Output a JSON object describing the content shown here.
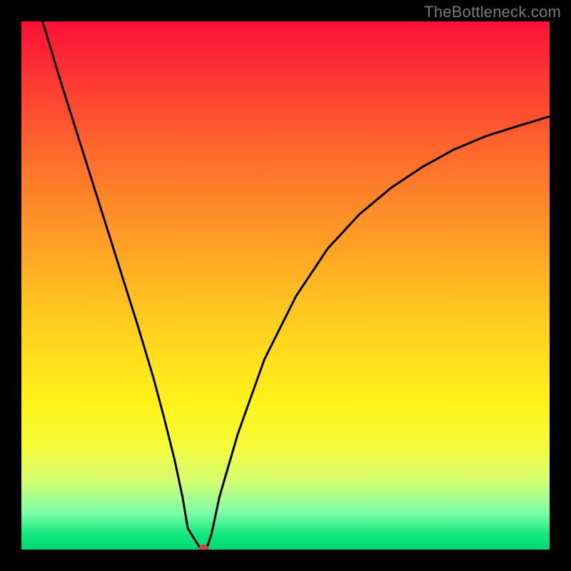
{
  "watermark": "TheBottleneck.com",
  "chart_data": {
    "type": "line",
    "title": "",
    "xlabel": "",
    "ylabel": "",
    "xlim": [
      0,
      100
    ],
    "ylim": [
      0,
      100
    ],
    "grid": false,
    "legend": false,
    "background_gradient_stops": [
      {
        "pct": 0,
        "color": "#fb1037"
      },
      {
        "pct": 12,
        "color": "#fd3b33"
      },
      {
        "pct": 25,
        "color": "#ff6a2d"
      },
      {
        "pct": 37,
        "color": "#ff8f27"
      },
      {
        "pct": 50,
        "color": "#ffb822"
      },
      {
        "pct": 62,
        "color": "#ffda1d"
      },
      {
        "pct": 72,
        "color": "#fff21a"
      },
      {
        "pct": 80,
        "color": "#f6fb37"
      },
      {
        "pct": 87,
        "color": "#d6fd72"
      },
      {
        "pct": 93,
        "color": "#7cfea7"
      },
      {
        "pct": 97,
        "color": "#17e87f"
      },
      {
        "pct": 100,
        "color": "#00d873"
      }
    ],
    "series": [
      {
        "name": "curve",
        "stroke": "#000000",
        "stroke_width": 3,
        "x": [
          4,
          7,
          10,
          13,
          16,
          19,
          22,
          25,
          27,
          29,
          30.5,
          31.5,
          34,
          35,
          36,
          37.5,
          41,
          46,
          52,
          58,
          64,
          70,
          76,
          82,
          88,
          94,
          100
        ],
        "y": [
          100,
          90,
          80.5,
          71,
          61.5,
          52,
          42.5,
          32.5,
          25,
          17,
          10,
          4,
          0,
          0,
          3,
          10,
          22,
          36,
          48,
          57,
          63.5,
          68.5,
          72.5,
          75.8,
          78.3,
          80.2,
          82
        ]
      }
    ],
    "marker": {
      "x": 34.5,
      "y": 0,
      "r": 1.0,
      "fill": "#c24a3e"
    }
  }
}
